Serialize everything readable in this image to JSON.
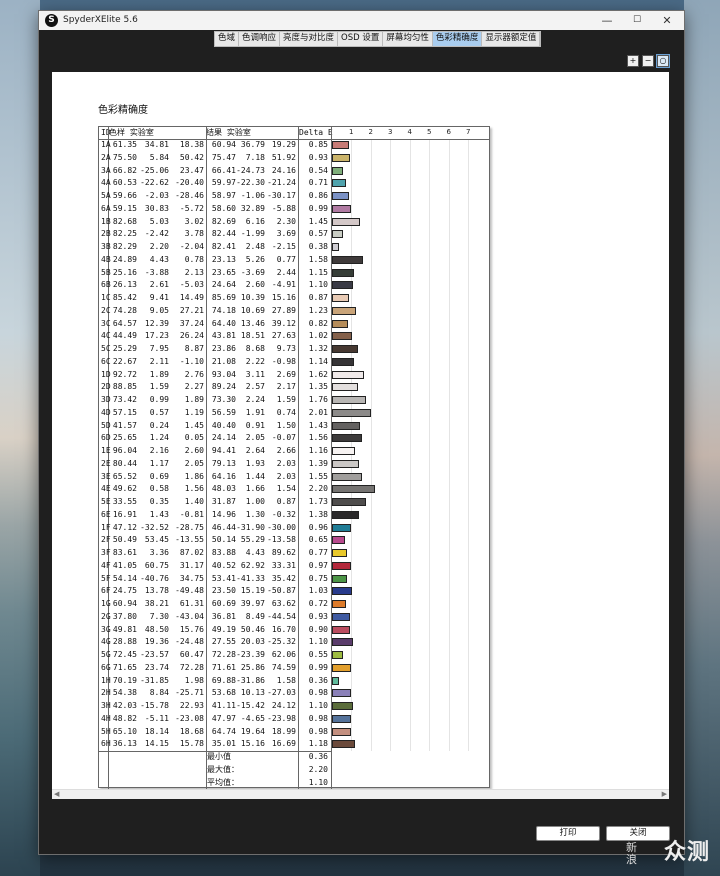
{
  "window": {
    "title": "SpyderXElite 5.6",
    "logo_letter": "S",
    "minimize_label": "—",
    "maximize_label": "☐",
    "close_label": "✕"
  },
  "tabs": [
    {
      "label": "色域",
      "active": false
    },
    {
      "label": "色调响应",
      "active": false
    },
    {
      "label": "亮度与对比度",
      "active": false
    },
    {
      "label": "OSD 设置",
      "active": false
    },
    {
      "label": "屏幕均匀性",
      "active": false
    },
    {
      "label": "色彩精确度",
      "active": true
    },
    {
      "label": "显示器额定值",
      "active": false
    }
  ],
  "zoom_buttons": [
    {
      "name": "zoom-in-icon",
      "glyph": "+"
    },
    {
      "name": "zoom-out-icon",
      "glyph": "−"
    },
    {
      "name": "zoom-fit-icon",
      "glyph": "○"
    }
  ],
  "report": {
    "title": "色彩精确度",
    "headers": {
      "id": "ID",
      "sample": "色样 实验室",
      "result": "结果 实验室",
      "delta": "Delta E"
    },
    "scale_ticks": [
      "1",
      "2",
      "3",
      "4",
      "5",
      "6",
      "7"
    ],
    "rows": [
      {
        "id": "1A",
        "s": [
          "61.35",
          "34.81",
          "18.38"
        ],
        "r": [
          "60.94",
          "36.79",
          "19.29"
        ],
        "d": 0.85,
        "color": "#c77b76"
      },
      {
        "id": "2A",
        "s": [
          "75.50",
          "5.84",
          "50.42"
        ],
        "r": [
          "75.47",
          "7.18",
          "51.92"
        ],
        "d": 0.93,
        "color": "#cbb46a"
      },
      {
        "id": "3A",
        "s": [
          "66.82",
          "-25.06",
          "23.47"
        ],
        "r": [
          "66.41",
          "-24.73",
          "24.16"
        ],
        "d": 0.54,
        "color": "#7fae7a"
      },
      {
        "id": "4A",
        "s": [
          "60.53",
          "-22.62",
          "-20.40"
        ],
        "r": [
          "59.97",
          "-22.30",
          "-21.24"
        ],
        "d": 0.71,
        "color": "#4fa3ad"
      },
      {
        "id": "5A",
        "s": [
          "59.66",
          "-2.03",
          "-28.46"
        ],
        "r": [
          "58.97",
          "-1.06",
          "-30.17"
        ],
        "d": 0.86,
        "color": "#7b92c6"
      },
      {
        "id": "6A",
        "s": [
          "59.15",
          "30.83",
          "-5.72"
        ],
        "r": [
          "58.60",
          "32.89",
          "-5.88"
        ],
        "d": 0.99,
        "color": "#b07aa2"
      },
      {
        "id": "1B",
        "s": [
          "82.68",
          "5.03",
          "3.02"
        ],
        "r": [
          "82.69",
          "6.16",
          "2.30"
        ],
        "d": 1.45,
        "color": "#d4c8c8"
      },
      {
        "id": "2B",
        "s": [
          "82.25",
          "-2.42",
          "3.78"
        ],
        "r": [
          "82.44",
          "-1.99",
          "3.69"
        ],
        "d": 0.57,
        "color": "#c9cdc4"
      },
      {
        "id": "3B",
        "s": [
          "82.29",
          "2.20",
          "-2.04"
        ],
        "r": [
          "82.41",
          "2.48",
          "-2.15"
        ],
        "d": 0.38,
        "color": "#cfcdd3"
      },
      {
        "id": "4B",
        "s": [
          "24.89",
          "4.43",
          "0.78"
        ],
        "r": [
          "23.13",
          "5.26",
          "0.77"
        ],
        "d": 1.58,
        "color": "#3f3a3a"
      },
      {
        "id": "5B",
        "s": [
          "25.16",
          "-3.88",
          "2.13"
        ],
        "r": [
          "23.65",
          "-3.69",
          "2.44"
        ],
        "d": 1.15,
        "color": "#363d37"
      },
      {
        "id": "6B",
        "s": [
          "26.13",
          "2.61",
          "-5.03"
        ],
        "r": [
          "24.64",
          "2.60",
          "-4.91"
        ],
        "d": 1.1,
        "color": "#393a44"
      },
      {
        "id": "1C",
        "s": [
          "85.42",
          "9.41",
          "14.49"
        ],
        "r": [
          "85.69",
          "10.39",
          "15.16"
        ],
        "d": 0.87,
        "color": "#e9cbb5"
      },
      {
        "id": "2C",
        "s": [
          "74.28",
          "9.05",
          "27.21"
        ],
        "r": [
          "74.18",
          "10.69",
          "27.89"
        ],
        "d": 1.23,
        "color": "#c9a479"
      },
      {
        "id": "3C",
        "s": [
          "64.57",
          "12.39",
          "37.24"
        ],
        "r": [
          "64.40",
          "13.46",
          "39.12"
        ],
        "d": 0.82,
        "color": "#b58c59"
      },
      {
        "id": "4C",
        "s": [
          "44.49",
          "17.23",
          "26.24"
        ],
        "r": [
          "43.81",
          "18.51",
          "27.63"
        ],
        "d": 1.02,
        "color": "#84604a"
      },
      {
        "id": "5C",
        "s": [
          "25.29",
          "7.95",
          "8.87"
        ],
        "r": [
          "23.86",
          "8.68",
          "9.73"
        ],
        "d": 1.32,
        "color": "#463831"
      },
      {
        "id": "6C",
        "s": [
          "22.67",
          "2.11",
          "-1.10"
        ],
        "r": [
          "21.08",
          "2.22",
          "-0.98"
        ],
        "d": 1.14,
        "color": "#363436"
      },
      {
        "id": "1D",
        "s": [
          "92.72",
          "1.89",
          "2.76"
        ],
        "r": [
          "93.04",
          "3.11",
          "2.69"
        ],
        "d": 1.62,
        "color": "#f0eaea"
      },
      {
        "id": "2D",
        "s": [
          "88.85",
          "1.59",
          "2.27"
        ],
        "r": [
          "89.24",
          "2.57",
          "2.17"
        ],
        "d": 1.35,
        "color": "#e3dfde"
      },
      {
        "id": "3D",
        "s": [
          "73.42",
          "0.99",
          "1.89"
        ],
        "r": [
          "73.30",
          "2.24",
          "1.59"
        ],
        "d": 1.76,
        "color": "#b8b6b4"
      },
      {
        "id": "4D",
        "s": [
          "57.15",
          "0.57",
          "1.19"
        ],
        "r": [
          "56.59",
          "1.91",
          "0.74"
        ],
        "d": 2.01,
        "color": "#8c8a89"
      },
      {
        "id": "5D",
        "s": [
          "41.57",
          "0.24",
          "1.45"
        ],
        "r": [
          "40.40",
          "0.91",
          "1.50"
        ],
        "d": 1.43,
        "color": "#636160"
      },
      {
        "id": "6D",
        "s": [
          "25.65",
          "1.24",
          "0.05"
        ],
        "r": [
          "24.14",
          "2.05",
          "-0.07"
        ],
        "d": 1.56,
        "color": "#3c3a3a"
      },
      {
        "id": "1E",
        "s": [
          "96.04",
          "2.16",
          "2.60"
        ],
        "r": [
          "94.41",
          "2.64",
          "2.66"
        ],
        "d": 1.16,
        "color": "#f7f3f2"
      },
      {
        "id": "2E",
        "s": [
          "80.44",
          "1.17",
          "2.05"
        ],
        "r": [
          "79.13",
          "1.93",
          "2.03"
        ],
        "d": 1.39,
        "color": "#cbc8c6"
      },
      {
        "id": "3E",
        "s": [
          "65.52",
          "0.69",
          "1.86"
        ],
        "r": [
          "64.16",
          "1.44",
          "2.03"
        ],
        "d": 1.55,
        "color": "#a09e9c"
      },
      {
        "id": "4E",
        "s": [
          "49.62",
          "0.58",
          "1.56"
        ],
        "r": [
          "48.03",
          "1.66",
          "1.54"
        ],
        "d": 2.2,
        "color": "#757371"
      },
      {
        "id": "5E",
        "s": [
          "33.55",
          "0.35",
          "1.40"
        ],
        "r": [
          "31.87",
          "1.00",
          "0.87"
        ],
        "d": 1.73,
        "color": "#4f4d4c"
      },
      {
        "id": "6E",
        "s": [
          "16.91",
          "1.43",
          "-0.81"
        ],
        "r": [
          "14.96",
          "1.30",
          "-0.32"
        ],
        "d": 1.38,
        "color": "#2a292a"
      },
      {
        "id": "1F",
        "s": [
          "47.12",
          "-32.52",
          "-28.75"
        ],
        "r": [
          "46.44",
          "-31.90",
          "-30.00"
        ],
        "d": 0.96,
        "color": "#1f7d96"
      },
      {
        "id": "2F",
        "s": [
          "50.49",
          "53.45",
          "-13.55"
        ],
        "r": [
          "50.14",
          "55.29",
          "-13.58"
        ],
        "d": 0.65,
        "color": "#b84a8e"
      },
      {
        "id": "3F",
        "s": [
          "83.61",
          "3.36",
          "87.02"
        ],
        "r": [
          "83.88",
          "4.43",
          "89.62"
        ],
        "d": 0.77,
        "color": "#e8c82a"
      },
      {
        "id": "4F",
        "s": [
          "41.05",
          "60.75",
          "31.17"
        ],
        "r": [
          "40.52",
          "62.92",
          "33.31"
        ],
        "d": 0.97,
        "color": "#b3283b"
      },
      {
        "id": "5F",
        "s": [
          "54.14",
          "-40.76",
          "34.75"
        ],
        "r": [
          "53.41",
          "-41.33",
          "35.42"
        ],
        "d": 0.75,
        "color": "#4c9546"
      },
      {
        "id": "6F",
        "s": [
          "24.75",
          "13.78",
          "-49.48"
        ],
        "r": [
          "23.50",
          "15.19",
          "-50.87"
        ],
        "d": 1.03,
        "color": "#283b8c"
      },
      {
        "id": "1G",
        "s": [
          "60.94",
          "38.21",
          "61.31"
        ],
        "r": [
          "60.69",
          "39.97",
          "63.62"
        ],
        "d": 0.72,
        "color": "#dd7b2a"
      },
      {
        "id": "2G",
        "s": [
          "37.80",
          "7.30",
          "-43.04"
        ],
        "r": [
          "36.81",
          "8.49",
          "-44.54"
        ],
        "d": 0.93,
        "color": "#3f5aa1"
      },
      {
        "id": "3G",
        "s": [
          "49.81",
          "48.50",
          "15.76"
        ],
        "r": [
          "49.19",
          "50.46",
          "16.70"
        ],
        "d": 0.9,
        "color": "#bb4d60"
      },
      {
        "id": "4G",
        "s": [
          "28.88",
          "19.36",
          "-24.48"
        ],
        "r": [
          "27.55",
          "20.03",
          "-25.32"
        ],
        "d": 1.1,
        "color": "#5a3c6b"
      },
      {
        "id": "5G",
        "s": [
          "72.45",
          "-23.57",
          "60.47"
        ],
        "r": [
          "72.28",
          "-23.39",
          "62.06"
        ],
        "d": 0.55,
        "color": "#9ebc41"
      },
      {
        "id": "6G",
        "s": [
          "71.65",
          "23.74",
          "72.28"
        ],
        "r": [
          "71.61",
          "25.86",
          "74.59"
        ],
        "d": 0.99,
        "color": "#e29f2c"
      },
      {
        "id": "1H",
        "s": [
          "70.19",
          "-31.85",
          "1.98"
        ],
        "r": [
          "69.88",
          "-31.86",
          "1.58"
        ],
        "d": 0.36,
        "color": "#5fbb9b"
      },
      {
        "id": "2H",
        "s": [
          "54.38",
          "8.84",
          "-25.71"
        ],
        "r": [
          "53.68",
          "10.13",
          "-27.03"
        ],
        "d": 0.98,
        "color": "#8a80b8"
      },
      {
        "id": "3H",
        "s": [
          "42.03",
          "-15.78",
          "22.93"
        ],
        "r": [
          "41.11",
          "-15.42",
          "24.12"
        ],
        "d": 1.1,
        "color": "#5a6c3a"
      },
      {
        "id": "4H",
        "s": [
          "48.82",
          "-5.11",
          "-23.08"
        ],
        "r": [
          "47.97",
          "-4.65",
          "-23.98"
        ],
        "d": 0.98,
        "color": "#54729a"
      },
      {
        "id": "5H",
        "s": [
          "65.10",
          "18.14",
          "18.68"
        ],
        "r": [
          "64.74",
          "19.64",
          "18.99"
        ],
        "d": 0.98,
        "color": "#c38f7f"
      },
      {
        "id": "6H",
        "s": [
          "36.13",
          "14.15",
          "15.78"
        ],
        "r": [
          "35.01",
          "15.16",
          "16.69"
        ],
        "d": 1.18,
        "color": "#6b4a3b"
      }
    ],
    "summary": [
      {
        "label": "最小值",
        "value": "0.36"
      },
      {
        "label": "最大值：",
        "value": "2.20"
      },
      {
        "label": "平均值：",
        "value": "1.10"
      }
    ]
  },
  "buttons": {
    "print": "打印",
    "close": "关闭"
  },
  "watermark": {
    "big": "众测",
    "small_top": "新",
    "small_bottom": "浪"
  }
}
